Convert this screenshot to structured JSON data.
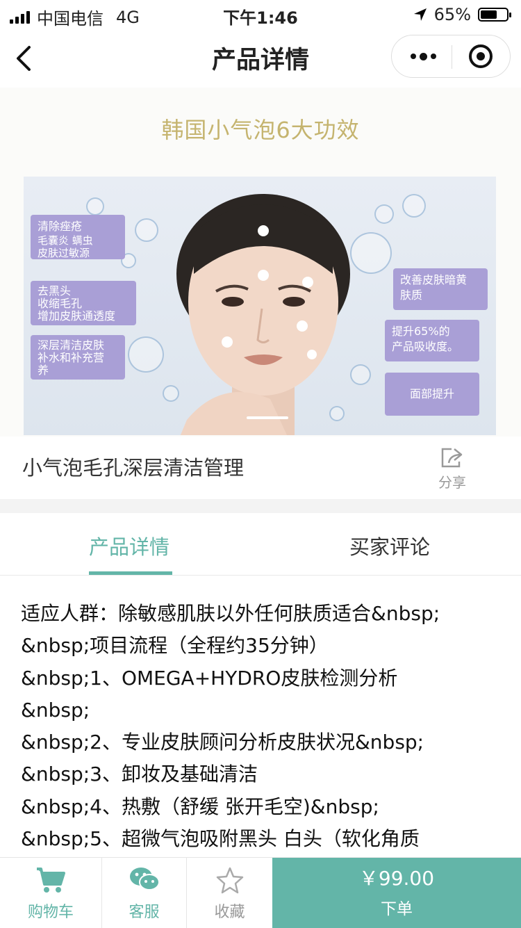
{
  "status": {
    "carrier": "中国电信",
    "network": "4G",
    "time": "下午1:46",
    "battery": "65%",
    "battery_level": 0.65
  },
  "nav": {
    "title": "产品详情"
  },
  "banner": {
    "headline": "韩国小气泡6大功效",
    "tags_left": [
      [
        "清除痤疮",
        "毛囊炎 螨虫",
        "皮肤过敏源"
      ],
      [
        "去黑头",
        "收缩毛孔",
        "增加皮肤通透度"
      ],
      [
        "深层清洁皮肤",
        "补水和补充营",
        "养"
      ]
    ],
    "tags_right": [
      [
        "改善皮肤暗黄",
        "肤质"
      ],
      [
        "提升65%的",
        "产品吸收度。"
      ],
      [
        "面部提升"
      ]
    ]
  },
  "product": {
    "title": "小气泡毛孔深层清洁管理",
    "share_label": "分享"
  },
  "tabs": [
    {
      "label": "产品详情"
    },
    {
      "label": "买家评论"
    }
  ],
  "content_lines": [
    "适应人群：除敏感肌肤以外任何肤质适合&nbsp;",
    "&nbsp;项目流程（全程约35分钟）",
    "&nbsp;1、OMEGA+HYDRO皮肤检测分析",
    "&nbsp;",
    "&nbsp;2、专业皮肤顾问分析皮肤状况&nbsp;",
    "&nbsp;3、卸妆及基础清洁",
    "&nbsp;4、热敷（舒缓 张开毛空)&nbsp;",
    "&nbsp;5、超微气泡吸附黑头 白头（软化角质"
  ],
  "bottom_bar": {
    "cart": "购物车",
    "service": "客服",
    "favorite": "收藏",
    "price": "￥99.00",
    "order": "下单"
  },
  "colors": {
    "accent": "#63b5a8",
    "tag": "#a99fd6",
    "headline": "#c5b46f"
  },
  "icons": [
    "back-arrow-icon",
    "more-dots-icon",
    "target-icon",
    "share-icon",
    "cart-icon",
    "wechat-icon",
    "star-icon"
  ]
}
